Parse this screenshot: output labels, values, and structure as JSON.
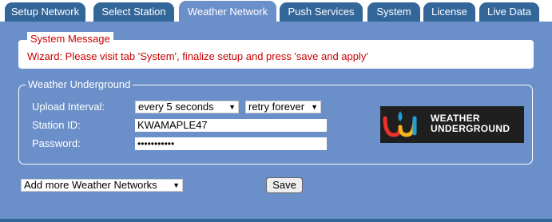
{
  "tabs": [
    {
      "label": "Setup Network",
      "active": false
    },
    {
      "label": "Select Station",
      "active": false
    },
    {
      "label": "Weather Network",
      "active": true
    },
    {
      "label": "Push Services",
      "active": false
    },
    {
      "label": "System",
      "active": false
    },
    {
      "label": "License",
      "active": false
    },
    {
      "label": "Live Data",
      "active": false
    }
  ],
  "system_message": {
    "legend": "System Message",
    "text": "Wizard: Please visit tab 'System', finalize setup and press 'save and apply'"
  },
  "weather_underground": {
    "legend": "Weather Underground",
    "upload_interval_label": "Upload Interval:",
    "upload_interval_value": "every 5 seconds",
    "retry_value": "retry forever",
    "station_id_label": "Station ID:",
    "station_id_value": "KWAMAPLE47",
    "password_label": "Password:",
    "password_value": "•••••••••••",
    "logo_line1": "WEATHER",
    "logo_line2": "UNDERGROUND"
  },
  "footer": {
    "add_networks_value": "Add more Weather Networks",
    "save_label": "Save"
  },
  "colors": {
    "tab_bg": "#336699",
    "active_tab_bg": "#6b8fc9",
    "message_red": "#cc0000",
    "wu_red": "#e8322a",
    "wu_yellow": "#f6b420",
    "wu_blue": "#1e9fd8"
  }
}
